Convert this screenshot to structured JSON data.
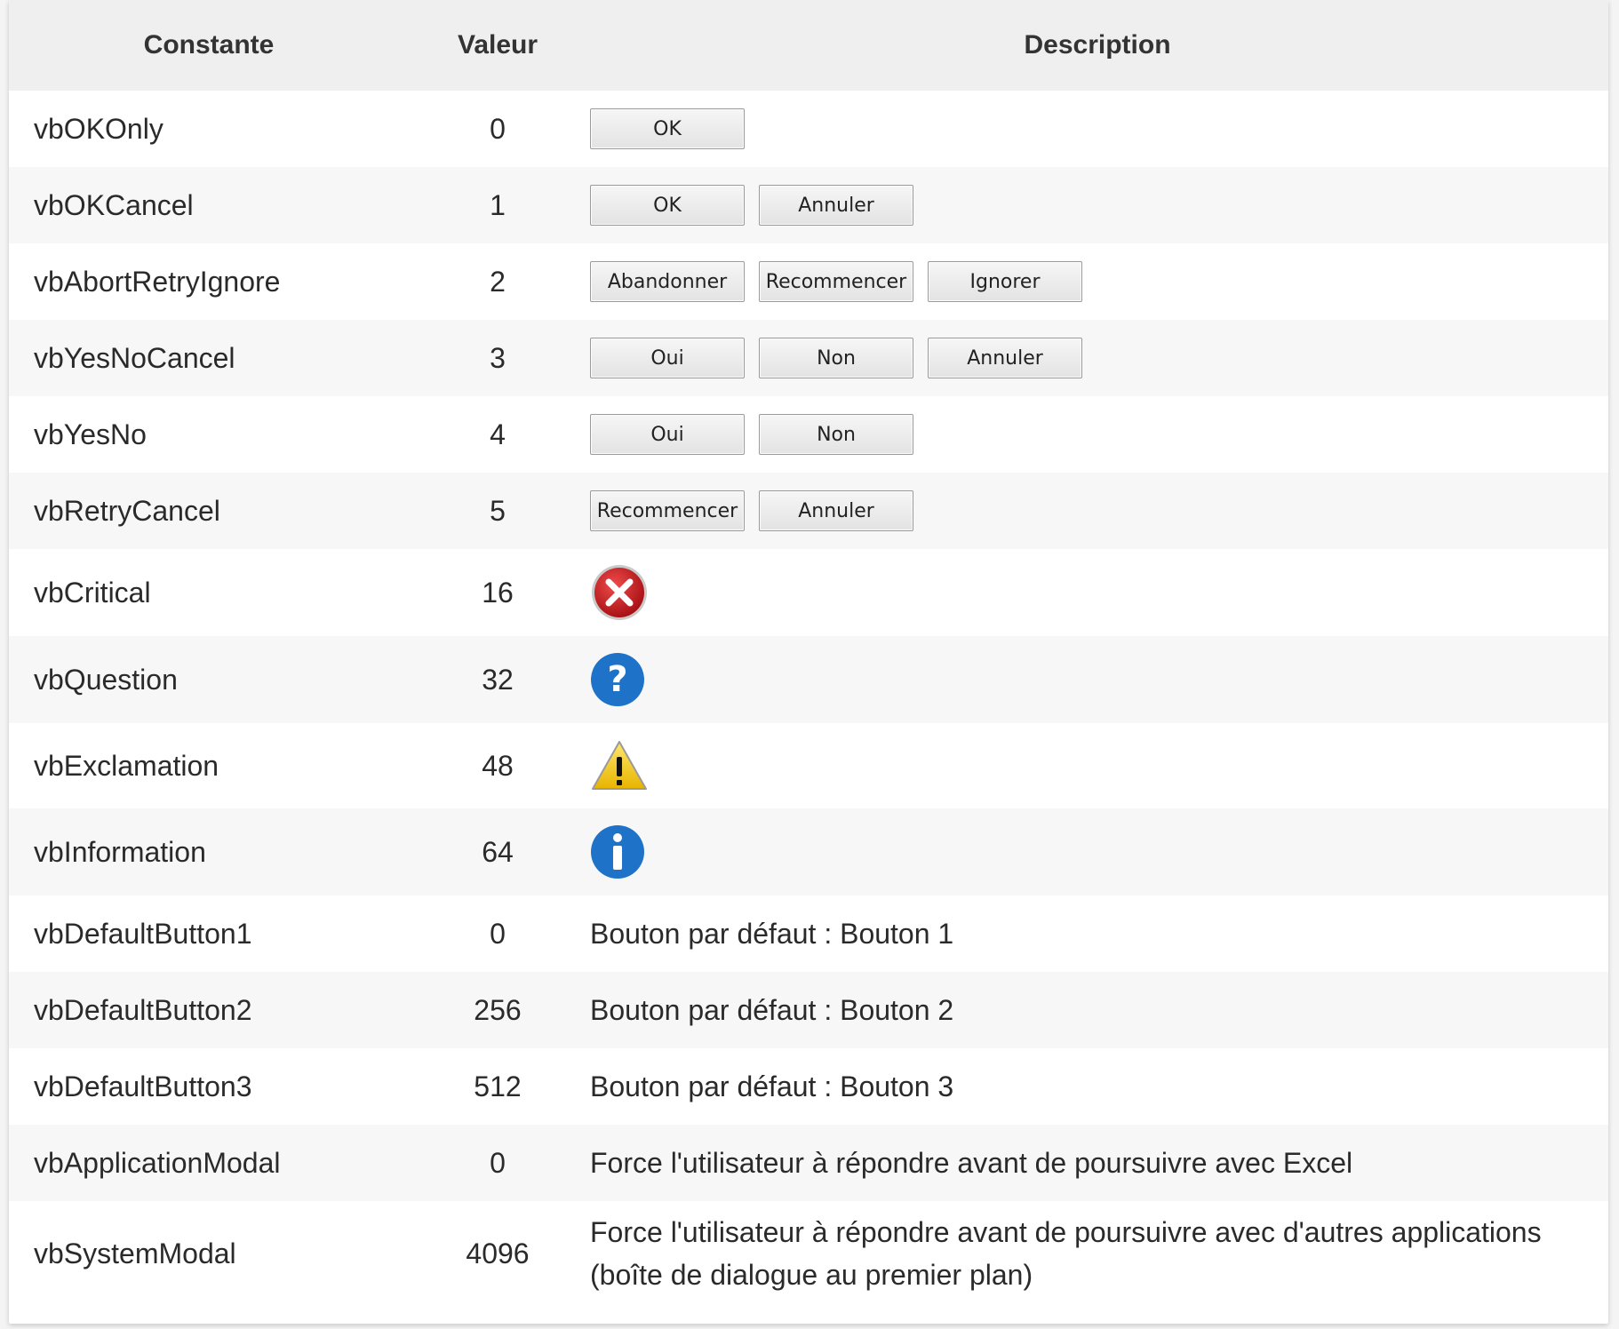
{
  "header": {
    "col1": "Constante",
    "col2": "Valeur",
    "col3": "Description"
  },
  "rows": [
    {
      "constant": "vbOKOnly",
      "value": "0",
      "buttons": [
        "OK"
      ]
    },
    {
      "constant": "vbOKCancel",
      "value": "1",
      "buttons": [
        "OK",
        "Annuler"
      ]
    },
    {
      "constant": "vbAbortRetryIgnore",
      "value": "2",
      "buttons": [
        "Abandonner",
        "Recommencer",
        "Ignorer"
      ]
    },
    {
      "constant": "vbYesNoCancel",
      "value": "3",
      "buttons": [
        "Oui",
        "Non",
        "Annuler"
      ]
    },
    {
      "constant": "vbYesNo",
      "value": "4",
      "buttons": [
        "Oui",
        "Non"
      ]
    },
    {
      "constant": "vbRetryCancel",
      "value": "5",
      "buttons": [
        "Recommencer",
        "Annuler"
      ]
    },
    {
      "constant": "vbCritical",
      "value": "16",
      "icon": "critical-error-icon"
    },
    {
      "constant": "vbQuestion",
      "value": "32",
      "icon": "question-icon"
    },
    {
      "constant": "vbExclamation",
      "value": "48",
      "icon": "exclamation-warning-icon"
    },
    {
      "constant": "vbInformation",
      "value": "64",
      "icon": "information-icon"
    },
    {
      "constant": "vbDefaultButton1",
      "value": "0",
      "description": "Bouton par défaut : Bouton 1"
    },
    {
      "constant": "vbDefaultButton2",
      "value": "256",
      "description": "Bouton par défaut : Bouton 2"
    },
    {
      "constant": "vbDefaultButton3",
      "value": "512",
      "description": "Bouton par défaut : Bouton 3"
    },
    {
      "constant": "vbApplicationModal",
      "value": "0",
      "description": "Force l'utilisateur à répondre avant de poursuivre avec Excel"
    },
    {
      "constant": "vbSystemModal",
      "value": "4096",
      "description": "Force l'utilisateur à répondre avant de poursuivre avec d'autres applications (boîte de dialogue au premier plan)"
    }
  ],
  "colors": {
    "critical": "#c8161d",
    "question": "#1e73c8",
    "warning": "#f2c40f",
    "information": "#1e73c8"
  }
}
